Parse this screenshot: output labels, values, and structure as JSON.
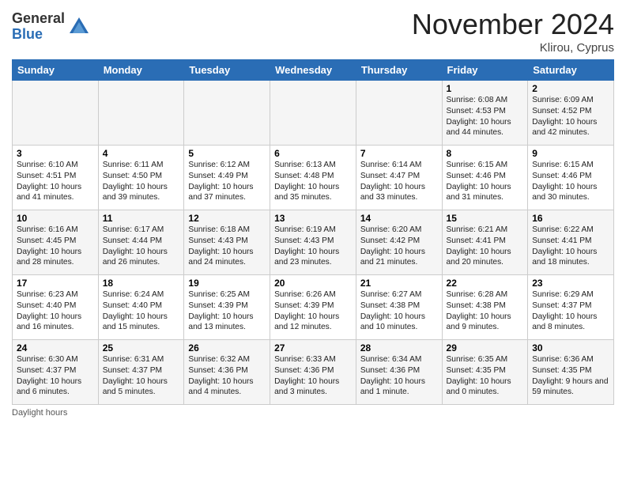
{
  "header": {
    "logo_general": "General",
    "logo_blue": "Blue",
    "month_title": "November 2024",
    "location": "Klirou, Cyprus"
  },
  "days_of_week": [
    "Sunday",
    "Monday",
    "Tuesday",
    "Wednesday",
    "Thursday",
    "Friday",
    "Saturday"
  ],
  "footer_label": "Daylight hours",
  "weeks": [
    [
      {
        "day": "",
        "sunrise": "",
        "sunset": "",
        "daylight": ""
      },
      {
        "day": "",
        "sunrise": "",
        "sunset": "",
        "daylight": ""
      },
      {
        "day": "",
        "sunrise": "",
        "sunset": "",
        "daylight": ""
      },
      {
        "day": "",
        "sunrise": "",
        "sunset": "",
        "daylight": ""
      },
      {
        "day": "",
        "sunrise": "",
        "sunset": "",
        "daylight": ""
      },
      {
        "day": "1",
        "sunrise": "Sunrise: 6:08 AM",
        "sunset": "Sunset: 4:53 PM",
        "daylight": "Daylight: 10 hours and 44 minutes."
      },
      {
        "day": "2",
        "sunrise": "Sunrise: 6:09 AM",
        "sunset": "Sunset: 4:52 PM",
        "daylight": "Daylight: 10 hours and 42 minutes."
      }
    ],
    [
      {
        "day": "3",
        "sunrise": "Sunrise: 6:10 AM",
        "sunset": "Sunset: 4:51 PM",
        "daylight": "Daylight: 10 hours and 41 minutes."
      },
      {
        "day": "4",
        "sunrise": "Sunrise: 6:11 AM",
        "sunset": "Sunset: 4:50 PM",
        "daylight": "Daylight: 10 hours and 39 minutes."
      },
      {
        "day": "5",
        "sunrise": "Sunrise: 6:12 AM",
        "sunset": "Sunset: 4:49 PM",
        "daylight": "Daylight: 10 hours and 37 minutes."
      },
      {
        "day": "6",
        "sunrise": "Sunrise: 6:13 AM",
        "sunset": "Sunset: 4:48 PM",
        "daylight": "Daylight: 10 hours and 35 minutes."
      },
      {
        "day": "7",
        "sunrise": "Sunrise: 6:14 AM",
        "sunset": "Sunset: 4:47 PM",
        "daylight": "Daylight: 10 hours and 33 minutes."
      },
      {
        "day": "8",
        "sunrise": "Sunrise: 6:15 AM",
        "sunset": "Sunset: 4:46 PM",
        "daylight": "Daylight: 10 hours and 31 minutes."
      },
      {
        "day": "9",
        "sunrise": "Sunrise: 6:15 AM",
        "sunset": "Sunset: 4:46 PM",
        "daylight": "Daylight: 10 hours and 30 minutes."
      }
    ],
    [
      {
        "day": "10",
        "sunrise": "Sunrise: 6:16 AM",
        "sunset": "Sunset: 4:45 PM",
        "daylight": "Daylight: 10 hours and 28 minutes."
      },
      {
        "day": "11",
        "sunrise": "Sunrise: 6:17 AM",
        "sunset": "Sunset: 4:44 PM",
        "daylight": "Daylight: 10 hours and 26 minutes."
      },
      {
        "day": "12",
        "sunrise": "Sunrise: 6:18 AM",
        "sunset": "Sunset: 4:43 PM",
        "daylight": "Daylight: 10 hours and 24 minutes."
      },
      {
        "day": "13",
        "sunrise": "Sunrise: 6:19 AM",
        "sunset": "Sunset: 4:43 PM",
        "daylight": "Daylight: 10 hours and 23 minutes."
      },
      {
        "day": "14",
        "sunrise": "Sunrise: 6:20 AM",
        "sunset": "Sunset: 4:42 PM",
        "daylight": "Daylight: 10 hours and 21 minutes."
      },
      {
        "day": "15",
        "sunrise": "Sunrise: 6:21 AM",
        "sunset": "Sunset: 4:41 PM",
        "daylight": "Daylight: 10 hours and 20 minutes."
      },
      {
        "day": "16",
        "sunrise": "Sunrise: 6:22 AM",
        "sunset": "Sunset: 4:41 PM",
        "daylight": "Daylight: 10 hours and 18 minutes."
      }
    ],
    [
      {
        "day": "17",
        "sunrise": "Sunrise: 6:23 AM",
        "sunset": "Sunset: 4:40 PM",
        "daylight": "Daylight: 10 hours and 16 minutes."
      },
      {
        "day": "18",
        "sunrise": "Sunrise: 6:24 AM",
        "sunset": "Sunset: 4:40 PM",
        "daylight": "Daylight: 10 hours and 15 minutes."
      },
      {
        "day": "19",
        "sunrise": "Sunrise: 6:25 AM",
        "sunset": "Sunset: 4:39 PM",
        "daylight": "Daylight: 10 hours and 13 minutes."
      },
      {
        "day": "20",
        "sunrise": "Sunrise: 6:26 AM",
        "sunset": "Sunset: 4:39 PM",
        "daylight": "Daylight: 10 hours and 12 minutes."
      },
      {
        "day": "21",
        "sunrise": "Sunrise: 6:27 AM",
        "sunset": "Sunset: 4:38 PM",
        "daylight": "Daylight: 10 hours and 10 minutes."
      },
      {
        "day": "22",
        "sunrise": "Sunrise: 6:28 AM",
        "sunset": "Sunset: 4:38 PM",
        "daylight": "Daylight: 10 hours and 9 minutes."
      },
      {
        "day": "23",
        "sunrise": "Sunrise: 6:29 AM",
        "sunset": "Sunset: 4:37 PM",
        "daylight": "Daylight: 10 hours and 8 minutes."
      }
    ],
    [
      {
        "day": "24",
        "sunrise": "Sunrise: 6:30 AM",
        "sunset": "Sunset: 4:37 PM",
        "daylight": "Daylight: 10 hours and 6 minutes."
      },
      {
        "day": "25",
        "sunrise": "Sunrise: 6:31 AM",
        "sunset": "Sunset: 4:37 PM",
        "daylight": "Daylight: 10 hours and 5 minutes."
      },
      {
        "day": "26",
        "sunrise": "Sunrise: 6:32 AM",
        "sunset": "Sunset: 4:36 PM",
        "daylight": "Daylight: 10 hours and 4 minutes."
      },
      {
        "day": "27",
        "sunrise": "Sunrise: 6:33 AM",
        "sunset": "Sunset: 4:36 PM",
        "daylight": "Daylight: 10 hours and 3 minutes."
      },
      {
        "day": "28",
        "sunrise": "Sunrise: 6:34 AM",
        "sunset": "Sunset: 4:36 PM",
        "daylight": "Daylight: 10 hours and 1 minute."
      },
      {
        "day": "29",
        "sunrise": "Sunrise: 6:35 AM",
        "sunset": "Sunset: 4:35 PM",
        "daylight": "Daylight: 10 hours and 0 minutes."
      },
      {
        "day": "30",
        "sunrise": "Sunrise: 6:36 AM",
        "sunset": "Sunset: 4:35 PM",
        "daylight": "Daylight: 9 hours and 59 minutes."
      }
    ]
  ]
}
